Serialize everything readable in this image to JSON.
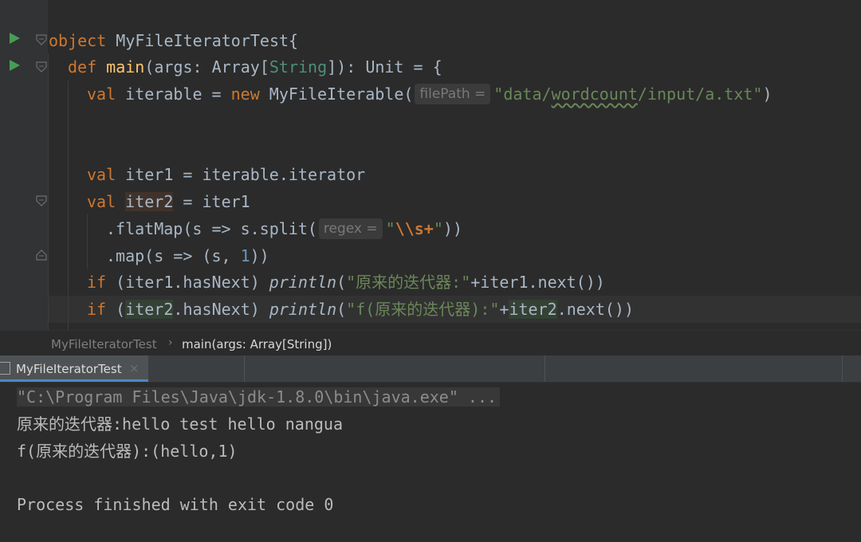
{
  "editor": {
    "line1": {
      "kw": "object",
      "name": "MyFileIteratorTest",
      "brace": "{"
    },
    "line2": {
      "kw": "def",
      "name": "main",
      "params_open": "(args: Array[",
      "type": "String",
      "params_close": "]): ",
      "ret": "Unit",
      "rest": " = {"
    },
    "line3": {
      "kw": "val",
      "mid": " iterable = ",
      "kw2": "new",
      "cls": " MyFileIterable(",
      "hint": "filePath =",
      "str_q1": "\"data/",
      "str_sq": "wordcount",
      "str_q2": "/input/a.txt\"",
      "close": ")"
    },
    "line4": {
      "kw": "val",
      "rest": " iter1 = iterable.iterator"
    },
    "line5": {
      "kw": "val",
      "var": "iter2",
      "rest": " = iter1"
    },
    "line6": {
      "pre": ".flatMap(s => s.split(",
      "hint": "regex =",
      "q1": "\"",
      "esc": "\\\\s+",
      "q2": "\"",
      "close": "))"
    },
    "line7": {
      "pre": ".map(s => (s, ",
      "num": "1",
      "close": "))"
    },
    "line8": {
      "kw": "if",
      "mid": " (iter1.hasNext) ",
      "fn": "println",
      "open": "(",
      "str": "\"原来的迭代器:\"",
      "rest": "+iter1.next())"
    },
    "line9": {
      "kw": "if",
      "open": " (",
      "var": "iter2",
      "mid": ".hasNext) ",
      "fn": "println",
      "open2": "(",
      "str": "\"f(原来的迭代器):\"",
      "plus": "+",
      "var2": "iter2",
      "rest": ".next())"
    }
  },
  "breadcrumb": {
    "item1": "MyFileIteratorTest",
    "sep": "›",
    "item2": "main(args: Array[String])"
  },
  "run_tab": {
    "label": "MyFileIteratorTest",
    "close": "×"
  },
  "console": {
    "cmd": "\"C:\\Program Files\\Java\\jdk-1.8.0\\bin\\java.exe\" ...",
    "out1": "原来的迭代器:hello test hello nangua",
    "out2": "f(原来的迭代器):(hello,1)",
    "out3": "Process finished with exit code 0"
  },
  "colors": {
    "keyword": "#cc7832",
    "string": "#6a8759",
    "function": "#ffc66d",
    "number": "#6897bb",
    "accent": "#4a88c7",
    "run": "#499c54"
  }
}
